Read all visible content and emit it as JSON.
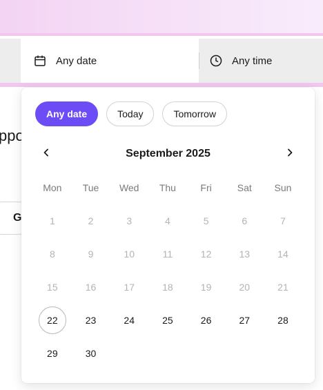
{
  "search": {
    "date_label": "Any date",
    "time_label": "Any time"
  },
  "background": {
    "partial_text": "ppo",
    "partial_button": "G"
  },
  "picker": {
    "chips": [
      {
        "label": "Any date",
        "active": true
      },
      {
        "label": "Today",
        "active": false
      },
      {
        "label": "Tomorrow",
        "active": false
      }
    ],
    "month_label": "September 2025",
    "weekdays": [
      "Mon",
      "Tue",
      "Wed",
      "Thu",
      "Fri",
      "Sat",
      "Sun"
    ],
    "weeks": [
      [
        "1",
        "2",
        "3",
        "4",
        "5",
        "6",
        "7"
      ],
      [
        "8",
        "9",
        "10",
        "11",
        "12",
        "13",
        "14"
      ],
      [
        "15",
        "16",
        "17",
        "18",
        "19",
        "20",
        "21"
      ],
      [
        "22",
        "23",
        "24",
        "25",
        "26",
        "27",
        "28"
      ],
      [
        "29",
        "30",
        "",
        "",
        "",
        "",
        ""
      ]
    ],
    "past_days": [
      "1",
      "2",
      "3",
      "4",
      "5",
      "6",
      "7",
      "8",
      "9",
      "10",
      "11",
      "12",
      "13",
      "14",
      "15",
      "16",
      "17",
      "18",
      "19",
      "20",
      "21"
    ],
    "today": "22"
  },
  "colors": {
    "accent": "#6c4df5",
    "pink": "#f1c6ef",
    "disabled_text": "#b3b3b3"
  },
  "icons": {
    "date": "calendar-icon",
    "time": "clock-icon",
    "prev": "chevron-left-icon",
    "next": "chevron-right-icon"
  }
}
